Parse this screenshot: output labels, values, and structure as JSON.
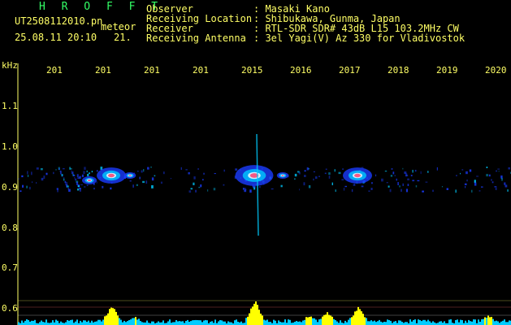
{
  "header": {
    "app_name": "H R O F F T",
    "file_name": "UT2508112010.pn",
    "mode": "meteor",
    "datetime": "25.08.11 20:10",
    "count": "21.",
    "fields": [
      {
        "label": "Observer",
        "value": ": Masaki Kano"
      },
      {
        "label": "Receiving Location",
        "value": ": Shibukawa, Gunma, Japan"
      },
      {
        "label": "Receiver",
        "value": ": RTL-SDR SDR# 43dB L15 103.2MHz CW"
      },
      {
        "label": "Receiving Antenna",
        "value": ": 3el Yagi(V) Az 330 for Vladivostok"
      }
    ]
  },
  "axis": {
    "unit": "kHz",
    "y_ticks": [
      "1.1",
      "1.0",
      "0.9",
      "0.8",
      "0.7",
      "0.6"
    ],
    "x_ticks": [
      "201",
      "201",
      "201",
      "201",
      "2015",
      "2016",
      "2017",
      "2018",
      "2019",
      "2020"
    ]
  },
  "colors": {
    "text": "#ffff66",
    "title": "#33ff66",
    "background": "#000000",
    "signal_core": "#ff3366",
    "signal_mid": "#00ccff",
    "signal_low": "#1a3cff",
    "histogram": "#ffff00"
  }
}
